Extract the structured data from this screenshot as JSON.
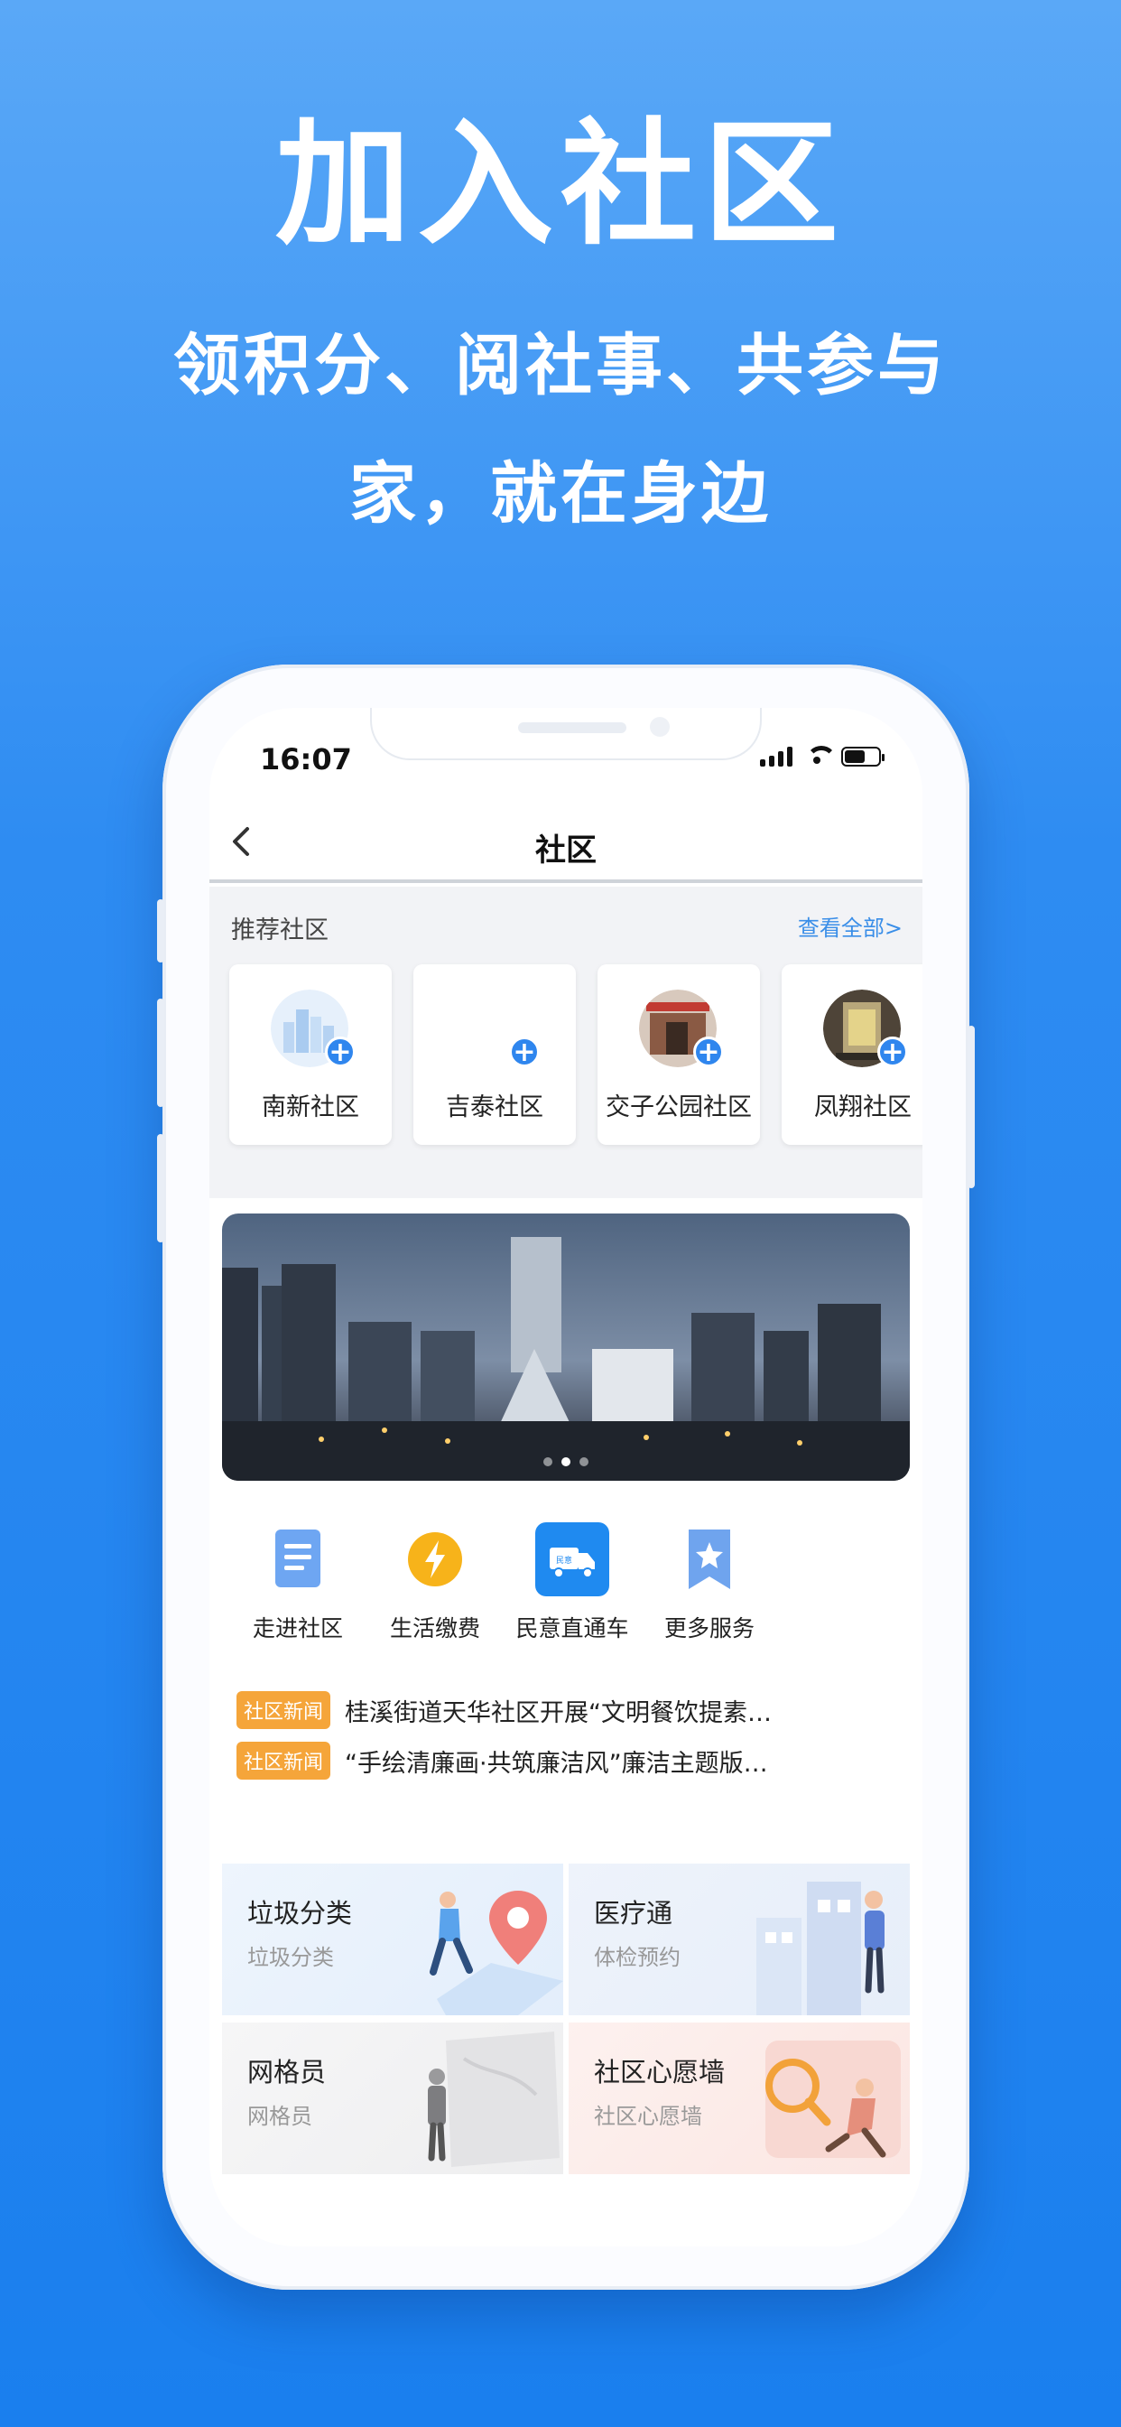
{
  "promo": {
    "title": "加入社区",
    "subtitle_line1": "领积分、阅社事、共参与",
    "subtitle_line2": "家，就在身边"
  },
  "status_bar": {
    "time": "16:07"
  },
  "navbar": {
    "title": "社区",
    "back_icon": "chevron-left-icon"
  },
  "recommended": {
    "heading": "推荐社区",
    "more_link": "查看全部>",
    "items": [
      {
        "name": "南新社区"
      },
      {
        "name": "吉泰社区"
      },
      {
        "name": "交子公园社区"
      },
      {
        "name": "凤翔社区"
      }
    ]
  },
  "banner": {
    "slides": 3,
    "active": 2
  },
  "services": [
    {
      "label": "走进社区",
      "icon": "document-icon"
    },
    {
      "label": "生活缴费",
      "icon": "lightning-icon"
    },
    {
      "label": "民意直通车",
      "icon": "truck-icon",
      "icon_badge": "民意"
    },
    {
      "label": "更多服务",
      "icon": "star-bookmark-icon"
    }
  ],
  "news": [
    {
      "tag": "社区新闻",
      "text": "桂溪街道天华社区开展“文明餐饮提素…"
    },
    {
      "tag": "社区新闻",
      "text": "“手绘清廉画·共筑廉洁风”廉洁主题版…"
    }
  ],
  "tiles": [
    {
      "title": "垃圾分类",
      "subtitle": "垃圾分类"
    },
    {
      "title": "医疗通",
      "subtitle": "体检预约"
    },
    {
      "title": "网格员",
      "subtitle": "网格员"
    },
    {
      "title": "社区心愿墙",
      "subtitle": "社区心愿墙"
    }
  ],
  "colors": {
    "accent": "#2f86ee",
    "tag": "#f5a53a",
    "background": "#1a7fee"
  }
}
